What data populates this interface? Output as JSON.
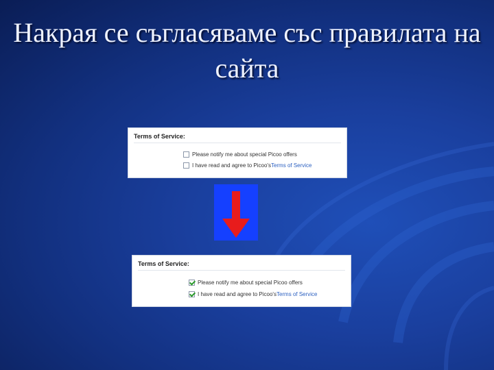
{
  "slide": {
    "title": "Накрая се съгласяваме със правилата на сайта",
    "background_color": "#12307f",
    "arrow_color": "#e81c1c",
    "arrow_box_color": "#1540ff"
  },
  "panel_before": {
    "heading": "Terms of Service:",
    "options": [
      {
        "label": "Please notify me about special Picoo offers",
        "checked": false
      },
      {
        "label_prefix": "I have read and agree to Picoo's ",
        "link": "Terms of Service",
        "checked": false
      }
    ]
  },
  "panel_after": {
    "heading": "Terms of Service:",
    "options": [
      {
        "label": "Please notify me about special Picoo offers",
        "checked": true
      },
      {
        "label_prefix": "I have read and agree to Picoo's ",
        "link": "Terms of Service",
        "checked": true
      }
    ]
  },
  "icons": {
    "arrow": "arrow-down-icon",
    "checkbox_checked": "checkmark-icon"
  }
}
